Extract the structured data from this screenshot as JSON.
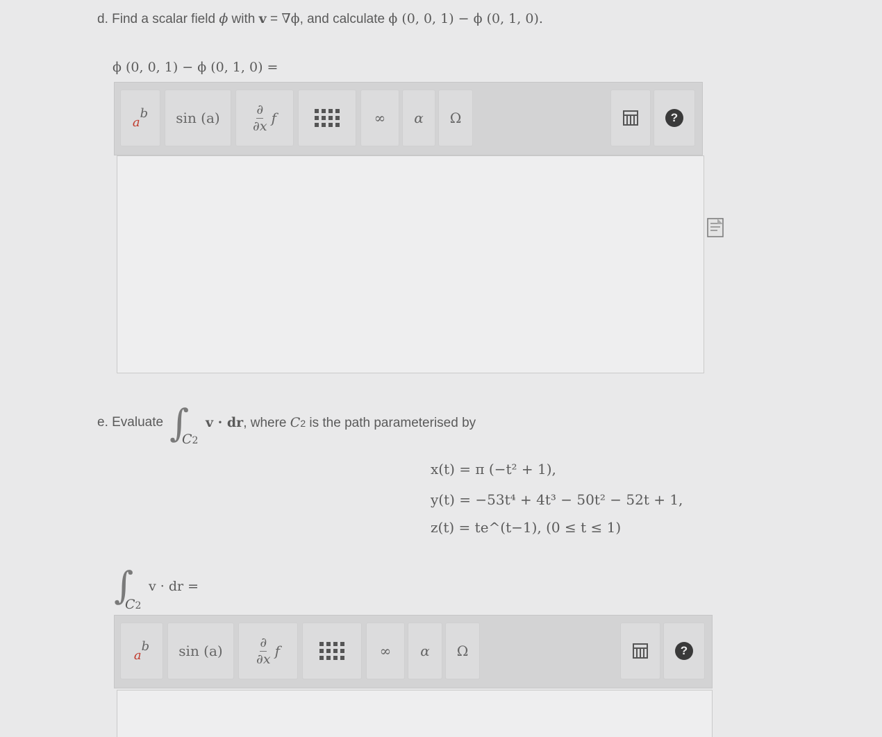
{
  "part_d": {
    "prefix": "d. Find a scalar field",
    "phi": "ϕ",
    "with": "with",
    "v": "v",
    "eq": "=",
    "grad": "∇ϕ",
    "calc": ", and calculate",
    "expr": "ϕ (0, 0, 1) − ϕ (0, 1, 0).",
    "answer_label": "ϕ (0, 0, 1) − ϕ (0, 1, 0) ="
  },
  "toolbar": {
    "power_base": "a",
    "power_exp": "b",
    "sin": "sin (a)",
    "partial_num": "∂",
    "partial_den": "∂x",
    "partial_f": "f",
    "infinity": "∞",
    "alpha": "α",
    "omega": "Ω",
    "help": "?"
  },
  "part_e": {
    "prefix": "e. Evaluate",
    "integral_sub": "C",
    "integral_sub_index": "2",
    "integrand": "v · dr",
    "where": ", where",
    "path_name": "C",
    "path_index": "2",
    "rest": "is the path parameterised by",
    "x_eq": "x(t) = π (−t² + 1),",
    "y_eq": "y(t) = −53t⁴ + 4t³ − 50t² − 52t + 1,",
    "z_eq": "z(t) = te^(t−1),   (0 ≤ t ≤ 1)",
    "answer_integrand": "v · dr ="
  }
}
